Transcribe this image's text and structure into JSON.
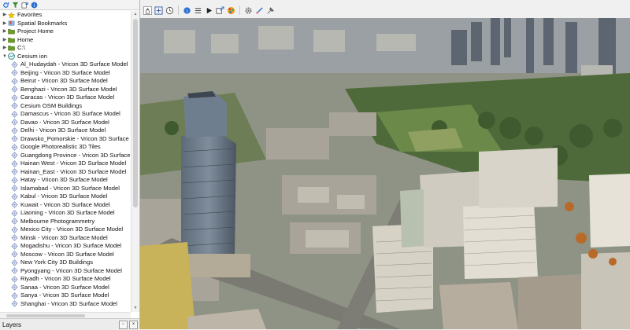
{
  "browser_panel": {
    "toolbar_icons": [
      "refresh-icon",
      "filter-icon",
      "collapse-all-icon",
      "help-icon"
    ],
    "items": [
      {
        "label": "Favorites",
        "icon": "star-icon",
        "indent": 0,
        "arrow": "collapsed"
      },
      {
        "label": "Spatial Bookmarks",
        "icon": "bookmark-icon",
        "indent": 0,
        "arrow": "collapsed"
      },
      {
        "label": "Project Home",
        "icon": "folder-icon",
        "indent": 0,
        "arrow": "collapsed"
      },
      {
        "label": "Home",
        "icon": "folder-icon",
        "indent": 0,
        "arrow": "collapsed"
      },
      {
        "label": "C:\\",
        "icon": "folder-icon",
        "indent": 0,
        "arrow": "collapsed"
      },
      {
        "label": "Cesium ion",
        "icon": "cesium-icon",
        "indent": 0,
        "arrow": "expanded"
      },
      {
        "label": "Al_Hudaydah - Vricon 3D Surface Model",
        "icon": "tileset-icon",
        "indent": 1
      },
      {
        "label": "Beijing - Vricon 3D Surface Model",
        "icon": "tileset-icon",
        "indent": 1
      },
      {
        "label": "Beirut - Vricon 3D Surface Model",
        "icon": "tileset-icon",
        "indent": 1
      },
      {
        "label": "Benghazi - Vricon 3D Surface Model",
        "icon": "tileset-icon",
        "indent": 1
      },
      {
        "label": "Caracas - Vricon 3D Surface Model",
        "icon": "tileset-icon",
        "indent": 1
      },
      {
        "label": "Cesium OSM Buildings",
        "icon": "tileset-icon",
        "indent": 1
      },
      {
        "label": "Damascus - Vricon 3D Surface Model",
        "icon": "tileset-icon",
        "indent": 1
      },
      {
        "label": "Davao - Vricon 3D Surface Model",
        "icon": "tileset-icon",
        "indent": 1
      },
      {
        "label": "Delhi - Vricon 3D Surface Model",
        "icon": "tileset-icon",
        "indent": 1
      },
      {
        "label": "Drawsko_Pomorskie - Vricon 3D Surface M",
        "icon": "tileset-icon",
        "indent": 1
      },
      {
        "label": "Google Photorealistic 3D Tiles",
        "icon": "tileset-icon",
        "indent": 1
      },
      {
        "label": "Guangdong Province - Vricon 3D Surface",
        "icon": "tileset-icon",
        "indent": 1
      },
      {
        "label": "Hainan West - Vricon 3D Surface Model",
        "icon": "tileset-icon",
        "indent": 1
      },
      {
        "label": "Hainan_East - Vricon 3D Surface Model",
        "icon": "tileset-icon",
        "indent": 1
      },
      {
        "label": "Hatay - Vricon 3D Surface Model",
        "icon": "tileset-icon",
        "indent": 1
      },
      {
        "label": "Islamabad - Vricon 3D Surface Model",
        "icon": "tileset-icon",
        "indent": 1
      },
      {
        "label": "Kabul - Vricon 3D Surface Model",
        "icon": "tileset-icon",
        "indent": 1
      },
      {
        "label": "Kuwait - Vricon 3D Surface Model",
        "icon": "tileset-icon",
        "indent": 1
      },
      {
        "label": "Liaoning - Vricon 3D Surface Model",
        "icon": "tileset-icon",
        "indent": 1
      },
      {
        "label": "Melbourne Photogrammetry",
        "icon": "tileset-icon",
        "indent": 1
      },
      {
        "label": "Mexico City - Vricon 3D Surface Model",
        "icon": "tileset-icon",
        "indent": 1
      },
      {
        "label": "Minsk - Vricon 3D Surface Model",
        "icon": "tileset-icon",
        "indent": 1
      },
      {
        "label": "Mogadishu - Vricon 3D Surface Model",
        "icon": "tileset-icon",
        "indent": 1
      },
      {
        "label": "Moscow - Vricon 3D Surface Model",
        "icon": "tileset-icon",
        "indent": 1
      },
      {
        "label": "New York City 3D Buildings",
        "icon": "tileset-icon",
        "indent": 1
      },
      {
        "label": "Pyongyang - Vricon 3D Surface Model",
        "icon": "tileset-icon",
        "indent": 1
      },
      {
        "label": "Riyadh - Vricon 3D Surface Model",
        "icon": "tileset-icon",
        "indent": 1
      },
      {
        "label": "Sanaa - Vricon 3D Surface Model",
        "icon": "tileset-icon",
        "indent": 1
      },
      {
        "label": "Sanya - Vricon 3D Surface Model",
        "icon": "tileset-icon",
        "indent": 1
      },
      {
        "label": "Shanghai - Vricon 3D Surface Model",
        "icon": "tileset-icon",
        "indent": 1
      }
    ]
  },
  "dock": {
    "title": "Layers",
    "buttons": [
      "float-icon",
      "close-icon"
    ]
  },
  "map_toolbar": {
    "tools": [
      "pan-icon",
      "zoom-full-icon",
      "temporal-icon",
      "identify-icon",
      "layer-list-icon",
      "play-icon",
      "export-icon",
      "color-icon",
      "settings-icon",
      "measure-icon",
      "tools-icon"
    ]
  },
  "colors": {
    "panel_bg": "#ffffff",
    "toolbar_bg": "#f0f0f0",
    "tileset_icon": "#6f86b5",
    "accent": "#2a6fd6"
  }
}
